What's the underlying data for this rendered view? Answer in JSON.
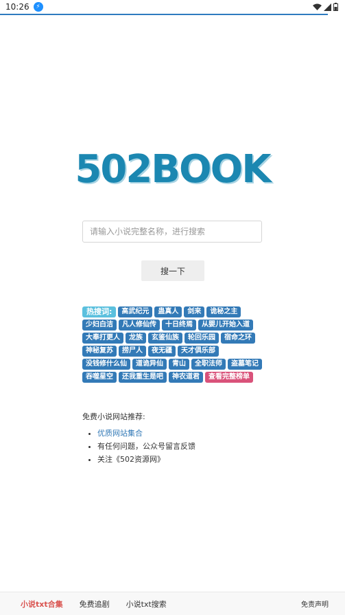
{
  "status": {
    "time": "10:26",
    "notif": "⚡"
  },
  "logo": "502BOOK",
  "search": {
    "placeholder": "请输入小说完整名称，进行搜索",
    "value": "",
    "button": "搜一下"
  },
  "hot": {
    "label": "热搜词:",
    "tags": [
      "高武纪元",
      "蛊真人",
      "剑来",
      "诡秘之主",
      "少妇白洁",
      "凡人修仙传",
      "十日终焉",
      "从婴儿开始入道",
      "大奉打更人",
      "龙族",
      "玄鉴仙族",
      "轮回乐园",
      "宿命之环",
      "神秘复苏",
      "捞尸人",
      "夜无疆",
      "天才俱乐部",
      "没钱修什么仙",
      "道诡异仙",
      "青山",
      "全职法师",
      "盗墓笔记",
      "吞噬星空",
      "还我重生是吧",
      "神农道君"
    ],
    "more": "查看完整榜单"
  },
  "recommend": {
    "title": "免费小说网站推荐:",
    "items": [
      "优质网站集合",
      "有任何问题，公众号留言反馈",
      "关注《502资源网》"
    ]
  },
  "nav": {
    "items": [
      "小说txt合集",
      "免费追剧",
      "小说txt搜索"
    ],
    "right": "免责声明"
  }
}
